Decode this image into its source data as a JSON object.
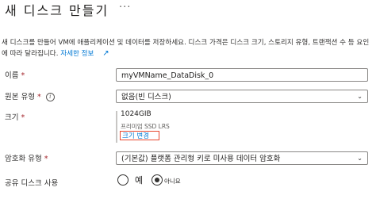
{
  "header": {
    "title": "새 디스크 만들기",
    "more_label": "..."
  },
  "description": {
    "text": "새 디스크를 만들어 VM에 애플리케이션 및 데이터를 저장하세요. 디스크 가격은 디스크 크기, 스토리지 유형, 트랜잭션 수 등 요인에 따라 달라집니다.",
    "link": "자세한 정보",
    "link_icon": "external-link-icon"
  },
  "form": {
    "name": {
      "label": "이름",
      "required_mark": "*",
      "value": "myVMName_DataDisk_0"
    },
    "source_type": {
      "label": "원본 유형",
      "required_mark": "*",
      "value": "없음(빈 디스크)",
      "info_icon": "i"
    },
    "size": {
      "label": "크기",
      "required_mark": "*",
      "value": "1024GIB",
      "sku": "프리미엄 SSD LRS",
      "change_link": "크기 변경"
    },
    "encryption": {
      "label": "암호화 유형",
      "required_mark": "*",
      "value": "(기본값) 플랫폼 관리형 키로 미사용 데이터 암호화"
    },
    "shared": {
      "label": "공유 디스크 사용",
      "yes": "예",
      "no": "아니요",
      "selected": "아니요"
    }
  }
}
